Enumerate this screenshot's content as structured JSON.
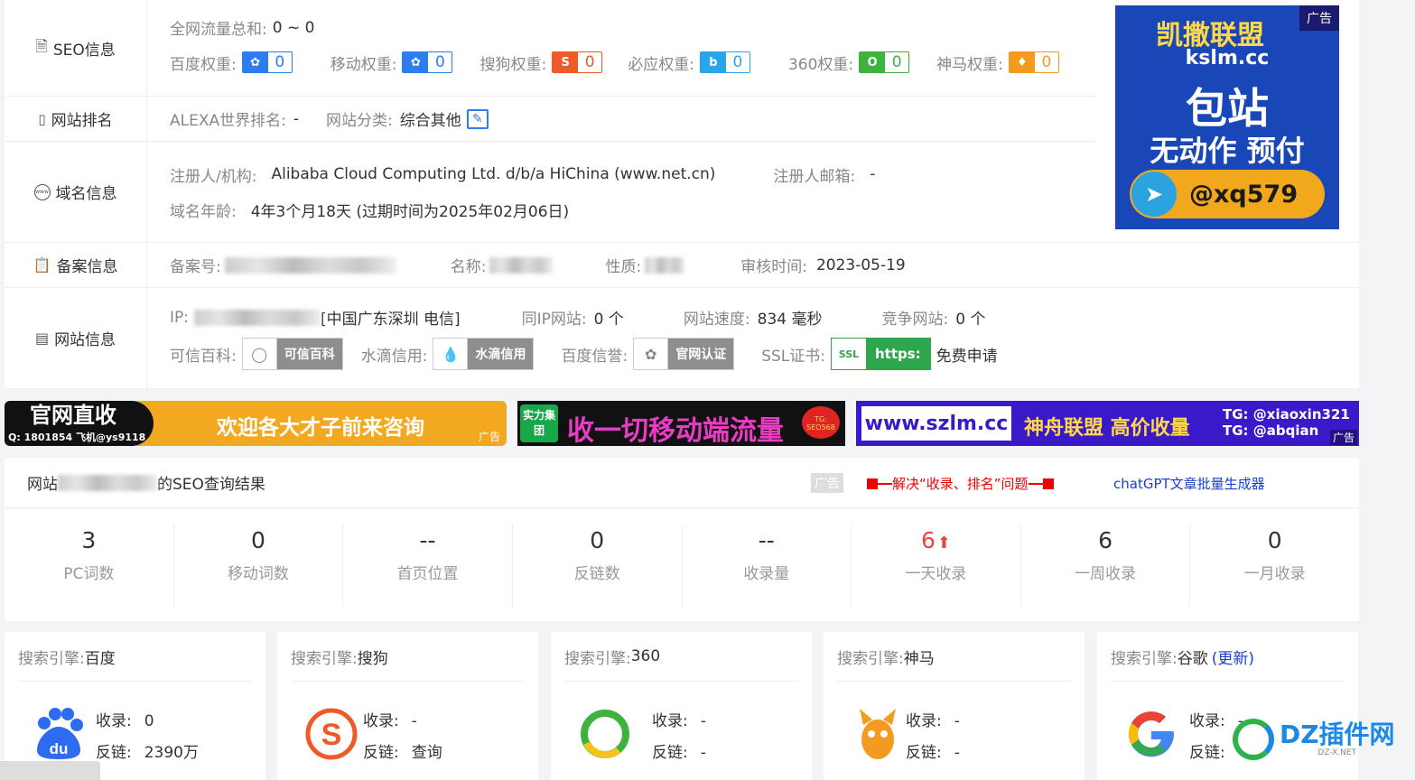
{
  "seo_info": {
    "label": "SEO信息",
    "total_traffic_label": "全网流量总和:",
    "total_traffic_value": "0 ~ 0",
    "weights": [
      {
        "label": "百度权重:",
        "value": "0",
        "color": "#2d7cf0",
        "icon": "baidu-paw-icon"
      },
      {
        "label": "移动权重:",
        "value": "0",
        "color": "#2d7cf0",
        "icon": "baidu-paw-icon"
      },
      {
        "label": "搜狗权重:",
        "value": "0",
        "color": "#f05a28",
        "icon": "sogou-s-icon"
      },
      {
        "label": "必应权重:",
        "value": "0",
        "color": "#2aa4ea",
        "icon": "bing-b-icon"
      },
      {
        "label": "360权重:",
        "value": "0",
        "color": "#3db33d",
        "icon": "360-o-icon"
      },
      {
        "label": "神马权重:",
        "value": "0",
        "color": "#f39a1f",
        "icon": "shenma-icon"
      }
    ]
  },
  "ranking": {
    "label": "网站排名",
    "alexa_label": "ALEXA世界排名:",
    "alexa_value": "-",
    "category_label": "网站分类:",
    "category_value": "综合其他"
  },
  "domain": {
    "label": "域名信息",
    "registrant_label": "注册人/机构:",
    "registrant_value": "Alibaba Cloud Computing Ltd. d/b/a HiChina (www.net.cn)",
    "email_label": "注册人邮箱:",
    "email_value": "-",
    "age_label": "域名年龄:",
    "age_value": "4年3个月18天 (过期时间为2025年02月06日)"
  },
  "icp": {
    "label": "备案信息",
    "number_label": "备案号:",
    "name_label": "名称:",
    "nature_label": "性质:",
    "audit_label": "审核时间:",
    "audit_value": "2023-05-19"
  },
  "site": {
    "label": "网站信息",
    "ip_label": "IP:",
    "ip_location": "[中国广东深圳 电信]",
    "same_ip_label": "同IP网站:",
    "same_ip_value": "0 个",
    "speed_label": "网站速度:",
    "speed_value": "834 毫秒",
    "competitor_label": "竞争网站:",
    "competitor_value": "0 个",
    "kexin_label": "可信百科:",
    "kexin_badge": "可信百科",
    "shuidi_label": "水滴信用:",
    "shuidi_badge": "水滴信用",
    "baidu_credit_label": "百度信誉:",
    "baidu_credit_badge": "官网认证",
    "ssl_label": "SSL证书:",
    "ssl_badge": "https:",
    "ssl_link": "免费申请"
  },
  "ads": {
    "right_brand": "凯撒联盟",
    "right_domain": "kslm.cc",
    "right_line1": "包站",
    "right_line2": "无动作 预付",
    "right_contact": "@xq579",
    "ad_tag": "广告",
    "strip1_left": "官网直收",
    "strip1_left_sub": "Q: 1801854 飞机@ys9118",
    "strip1_right": "欢迎各大才子前来咨询",
    "strip2_badge": "实力集团",
    "strip2_text": "收一切移动端流量",
    "strip2_tag": "TG: SEO568",
    "strip3_domain": "www.szlm.cc",
    "strip3_text": "神舟联盟 高价收量",
    "strip3_tg1": "TG: @xiaoxin321",
    "strip3_tg2": "TG: @abqian"
  },
  "results": {
    "title_prefix": "网站",
    "title_suffix": "的SEO查询结果",
    "ad_tag": "广告",
    "promo1": "解决“收录、排名”问题",
    "promo2": "chatGPT文章批量生成器",
    "stats": [
      {
        "value": "3",
        "label": "PC词数"
      },
      {
        "value": "0",
        "label": "移动词数"
      },
      {
        "value": "--",
        "label": "首页位置"
      },
      {
        "value": "0",
        "label": "反链数"
      },
      {
        "value": "--",
        "label": "收录量"
      },
      {
        "value": "6",
        "label": "一天收录",
        "highlight": true
      },
      {
        "value": "6",
        "label": "一周收录"
      },
      {
        "value": "0",
        "label": "一月收录"
      }
    ]
  },
  "engines": [
    {
      "prefix": "搜索引擎:",
      "name": "百度",
      "index_label": "收录:",
      "index_value": "0",
      "backlink_label": "反链:",
      "backlink_value": "2390万",
      "icon": "baidu-logo-icon"
    },
    {
      "prefix": "搜索引擎:",
      "name": "搜狗",
      "index_label": "收录:",
      "index_value": "-",
      "backlink_label": "反链:",
      "backlink_value": "查询",
      "icon": "sogou-logo-icon"
    },
    {
      "prefix": "搜索引擎:",
      "name": "360",
      "index_label": "收录:",
      "index_value": "-",
      "backlink_label": "反链:",
      "backlink_value": "-",
      "icon": "360-logo-icon"
    },
    {
      "prefix": "搜索引擎:",
      "name": "神马",
      "index_label": "收录:",
      "index_value": "-",
      "backlink_label": "反链:",
      "backlink_value": "-",
      "icon": "shenma-logo-icon"
    },
    {
      "prefix": "搜索引擎:",
      "name": "谷歌",
      "update": "(更新)",
      "index_label": "收录:",
      "index_value": "-",
      "backlink_label": "反链:",
      "backlink_value": "",
      "icon": "google-logo-icon"
    }
  ],
  "watermark": {
    "text": "DZ插件网",
    "sub": "DZ-X.NET"
  }
}
